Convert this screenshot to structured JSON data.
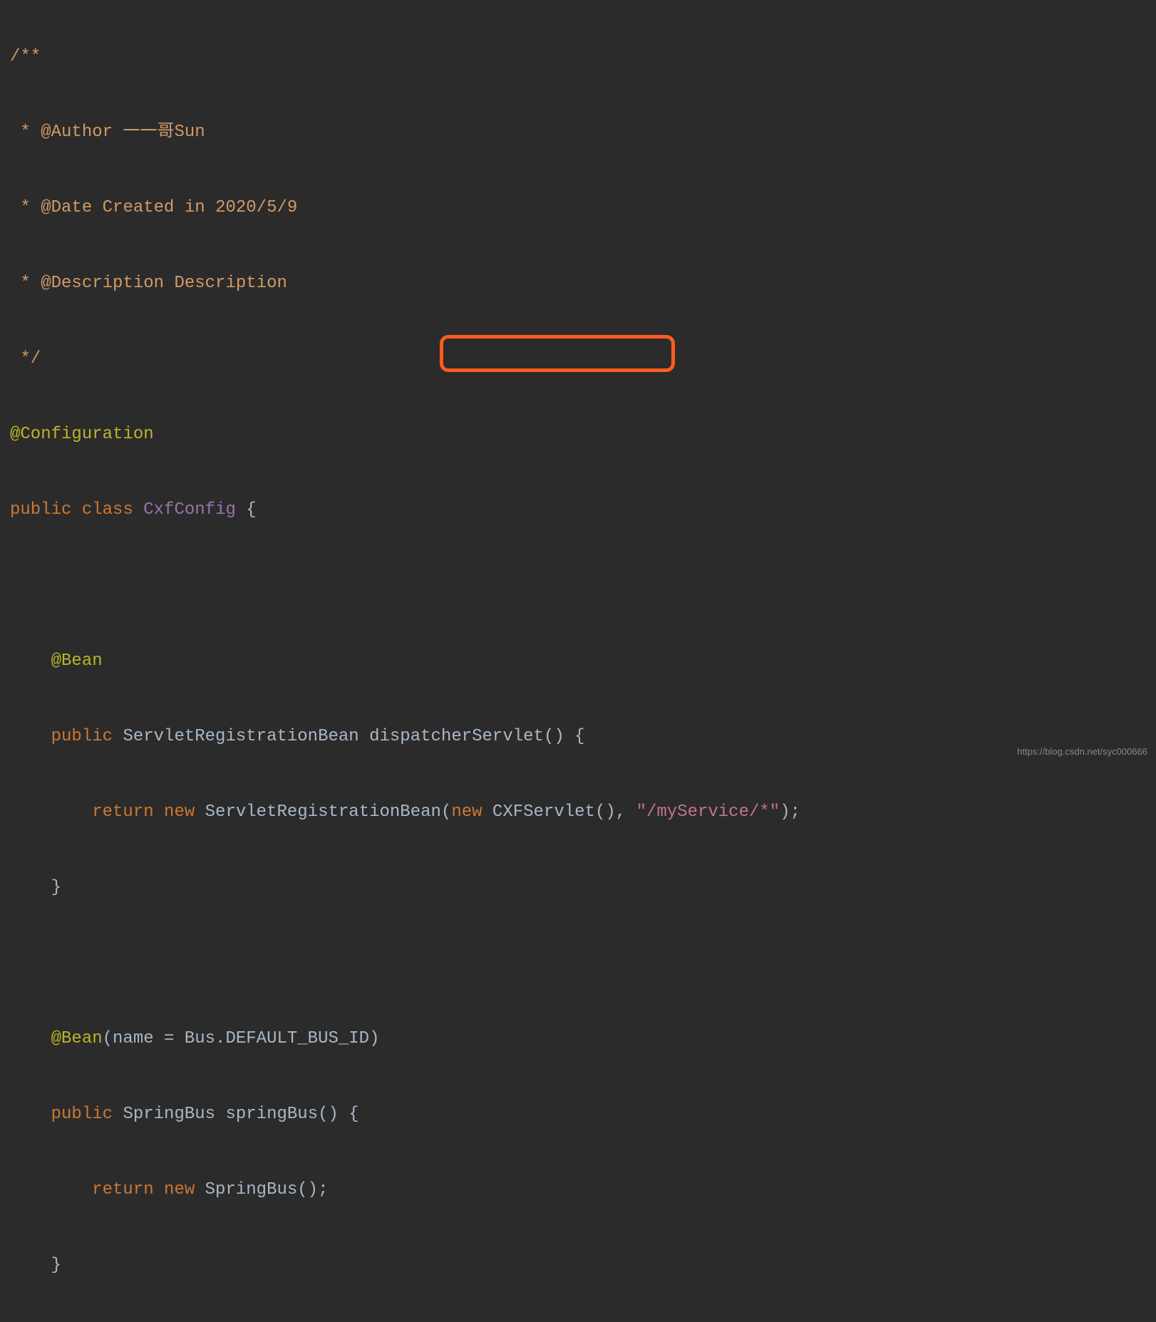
{
  "code": {
    "line1": "/**",
    "line2_prefix": " * ",
    "line2_tag": "@Author",
    "line2_text": " 一一哥Sun",
    "line3_prefix": " * ",
    "line3_tag": "@Date",
    "line3_text": " Created in 2020/5/9",
    "line4_prefix": " * ",
    "line4_tag": "@Description",
    "line4_text": " Description",
    "line5": " */",
    "line6_annotation": "@Configuration",
    "line7_public": "public ",
    "line7_class": "class ",
    "line7_classname": "CxfConfig ",
    "line7_brace": "{",
    "line9_indent": "    ",
    "line9_annotation": "@Bean",
    "line10_indent": "    ",
    "line10_public": "public ",
    "line10_type": "ServletRegistrationBean ",
    "line10_method": "dispatcherServlet",
    "line10_parens": "() {",
    "line11_indent": "        ",
    "line11_return": "return ",
    "line11_new": "new ",
    "line11_type": "ServletRegistrationBean(",
    "line11_new2": "new ",
    "line11_type2": "CXFServlet(), ",
    "line11_string": "\"/myService/*\"",
    "line11_end": ");",
    "line12_indent": "    ",
    "line12_brace": "}",
    "line14_indent": "    ",
    "line14_annotation": "@Bean",
    "line14_params": "(name = Bus.DEFAULT_BUS_ID)",
    "line15_indent": "    ",
    "line15_public": "public ",
    "line15_type": "SpringBus ",
    "line15_method": "springBus",
    "line15_parens": "() {",
    "line16_indent": "        ",
    "line16_return": "return ",
    "line16_new": "new ",
    "line16_type": "SpringBus();",
    "line17_indent": "    ",
    "line17_brace": "}"
  },
  "watermark": "https://blog.csdn.net/syc000666"
}
